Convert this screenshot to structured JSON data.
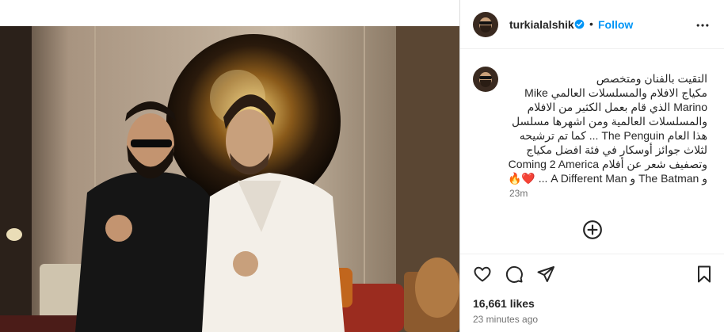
{
  "post": {
    "username": "turkialalshik",
    "follow_label": "Follow",
    "separator": "•",
    "caption_lines": [
      "التقيت بالفنان ومتخصص",
      "مكياج الافلام والمسلسلات العالمي Mike",
      "Marino الذي قام بعمل الكثير من الافلام",
      "والمسلسلات العالمية ومن اشهرها مسلسل",
      "هذا العام The Penguin ... كما تم ترشيحه",
      "لثلاث جوائز أوسكار في فئة افضل مكياج",
      "وتصفيف شعر عن أفلام Coming 2 America",
      "و The Batman و A Different Man ... ❤️🔥"
    ],
    "caption_time": "23m",
    "likes": "16,661 likes",
    "posted_ago": "23 minutes ago"
  },
  "icons": {
    "verified": "verified-badge-icon",
    "more": "more-options-icon",
    "like": "heart-icon",
    "comment": "comment-icon",
    "share": "share-icon",
    "save": "bookmark-icon",
    "add_comment": "add-circle-icon"
  },
  "colors": {
    "accent": "#0095f6",
    "text": "#262626",
    "muted": "#737373",
    "border": "#dbdbdb"
  }
}
